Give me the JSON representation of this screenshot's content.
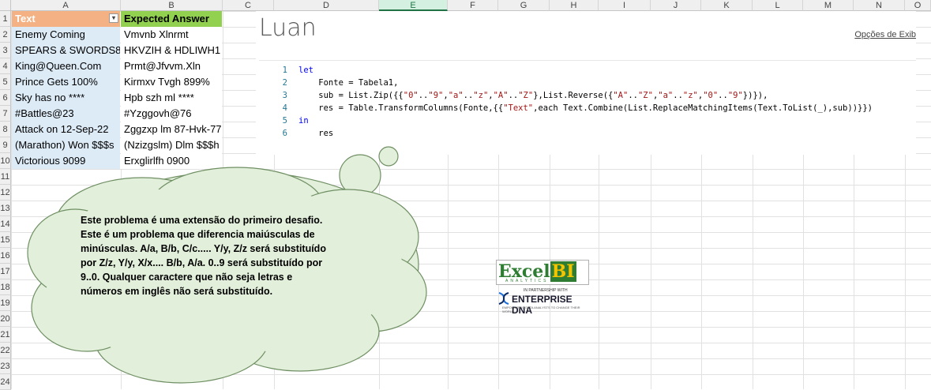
{
  "columns": [
    "A",
    "B",
    "C",
    "D",
    "E",
    "F",
    "G",
    "H",
    "I",
    "J",
    "K",
    "L",
    "M",
    "N",
    "O"
  ],
  "rows": [
    "1",
    "2",
    "3",
    "4",
    "5",
    "6",
    "7",
    "8",
    "9",
    "10",
    "11",
    "12",
    "13",
    "14",
    "15",
    "16",
    "17",
    "18",
    "19",
    "20",
    "21",
    "22",
    "23",
    "24"
  ],
  "table": {
    "headers": [
      "Text",
      "Expected Answer"
    ],
    "rows": [
      [
        "Enemy Coming",
        "Vmvnb Xlnrmt"
      ],
      [
        "SPEARS & SWORDS8",
        "HKVZIH & HDLIWH1"
      ],
      [
        "King@Queen.Com",
        "Prmt@Jfvvm.Xln"
      ],
      [
        "Prince Gets 100%",
        "Kirmxv Tvgh 899%"
      ],
      [
        "Sky has no ****",
        "Hpb szh ml ****"
      ],
      [
        "#Battles@23",
        "#Yzggovh@76"
      ],
      [
        "Attack on 12-Sep-22",
        "Zggzxp lm 87-Hvk-77"
      ],
      [
        "(Marathon) Won $$$s",
        "(Nzizgslm) Dlm $$$h"
      ],
      [
        "Victorious 9099",
        "Erxglirlfh 0900"
      ]
    ]
  },
  "query_panel": {
    "title": "Luan",
    "options_link": "Opções de Exib",
    "code_lines": [
      {
        "n": "1",
        "text": "let"
      },
      {
        "n": "2",
        "text": "    Fonte = Tabela1,"
      },
      {
        "n": "3",
        "text": "    sub = List.Zip({{\"0\"..\"9\",\"a\"..\"z\",\"A\"..\"Z\"},List.Reverse({\"A\"..\"Z\",\"a\"..\"z\",\"0\"..\"9\"})}),"
      },
      {
        "n": "4",
        "text": "    res = Table.TransformColumns(Fonte,{{\"Text\",each Text.Combine(List.ReplaceMatchingItems(Text.ToList(_),sub))}})"
      },
      {
        "n": "5",
        "text": "in"
      },
      {
        "n": "6",
        "text": "    res"
      }
    ]
  },
  "callout": {
    "text": "Este problema é uma extensão do primeiro desafio. Este é um problema que diferencia maiúsculas de minúsculas. A/a, B/b, C/c..... Y/y, Z/z será substituído por Z/z, Y/y, X/x.... B/b, A/a. 0..9 será substituído por 9..0. Qualquer caractere que não seja letras e números em inglês não será substituído."
  },
  "logo": {
    "excel": "Excel",
    "bi": "BI",
    "analytics": "ANALYTICS",
    "partner": "IN PARTNERSHIP WITH",
    "edna": "ENTERPRISE DNA",
    "tagline": "EMPOWERING DATA ANALYSTS TO CHANGE THEIR WORLD"
  },
  "colors": {
    "header_text": "#f4b183",
    "header_expected": "#92d050",
    "col_a_fill": "#ddebf7",
    "cloud_fill": "#e2efda",
    "keyword": "#0000ff",
    "string": "#a31515"
  }
}
